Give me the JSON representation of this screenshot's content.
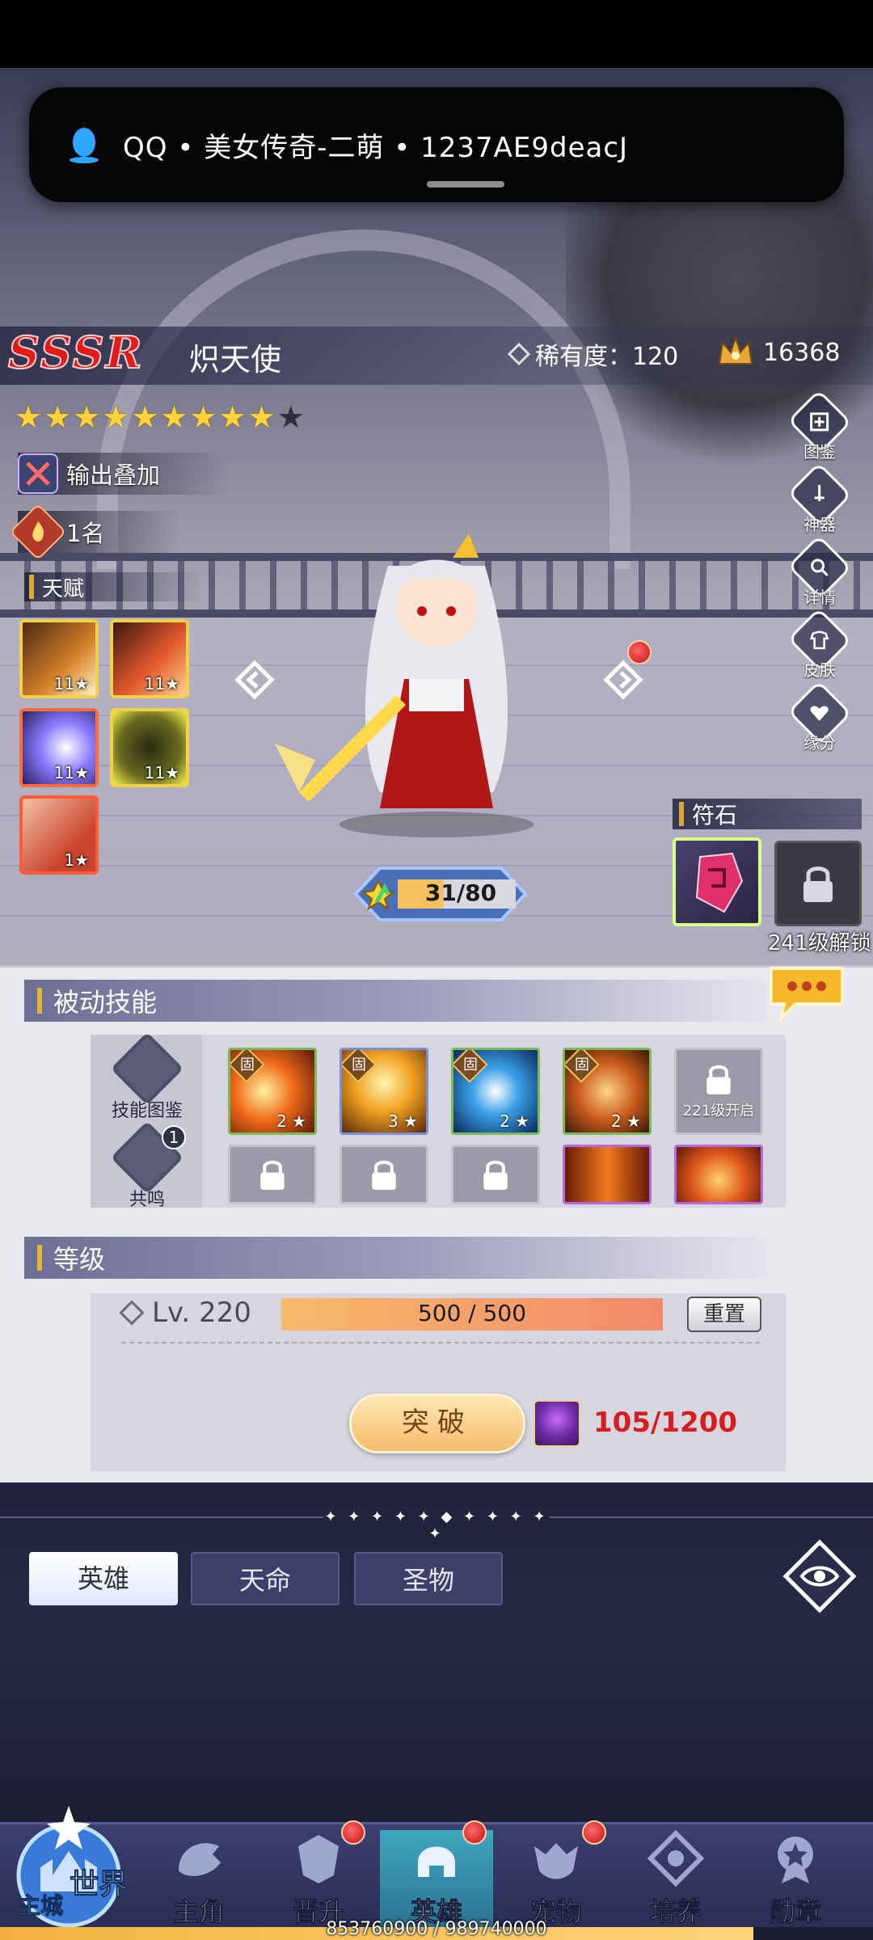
{
  "notification": {
    "text": "QQ • 美女传奇-二萌 • 1237AE9deacJ"
  },
  "hero": {
    "rank": "SSSR",
    "name": "炽天使",
    "rarity_label": "稀有度：120",
    "power": "16368",
    "stars_filled": 9,
    "stars_total": 10,
    "tag1": "输出叠加",
    "tag2": "1名"
  },
  "talent": {
    "label": "天赋",
    "skills": [
      "11",
      "11",
      "11",
      "11",
      "1"
    ]
  },
  "side_menu": [
    "图鉴",
    "神器",
    "详情",
    "皮肤",
    "缘分"
  ],
  "exp": {
    "text": "31/80",
    "current": 31,
    "max": 80
  },
  "rune": {
    "label": "符石",
    "unlock_text": "241级解锁"
  },
  "passive": {
    "title": "被动技能",
    "side_btn1": "技能图鉴",
    "side_btn2": "共鸣",
    "resonance_badge": "1",
    "fixed_label": "固",
    "skills": [
      "2",
      "3",
      "2",
      "2"
    ],
    "lock_text": "221级开启"
  },
  "level": {
    "title": "等级",
    "lv_text": "Lv. 220",
    "bar_text": "500 / 500",
    "reset_label": "重置",
    "break_label": "突破",
    "orb_count": "105/1200"
  },
  "tabs": [
    "英雄",
    "天命",
    "圣物"
  ],
  "nav": {
    "world": "世界",
    "city": "主城",
    "items": [
      "主角",
      "晋升",
      "英雄",
      "宠物",
      "培养",
      "勋章"
    ]
  },
  "progress": {
    "text": "853760900 / 989740000",
    "current": 853760900,
    "max": 989740000
  },
  "colors": {
    "rank_red": "#e21a1a",
    "star_gold": "#ffd23a",
    "level_bar": "#f4a86a",
    "orb_count_red": "#d51f1f",
    "panel_bg": "#e9e8ef",
    "nav_bg": "#3a3f6e"
  }
}
